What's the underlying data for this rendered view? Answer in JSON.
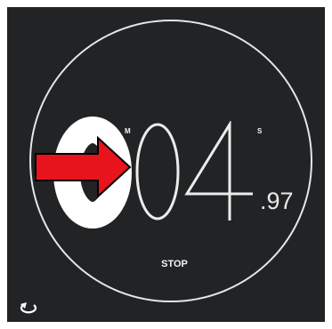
{
  "stopwatch": {
    "minutes": "0",
    "minutes_unit": "M",
    "seconds": "04",
    "seconds_unit": "S",
    "hundredths": ".97"
  },
  "controls": {
    "stop_label": "STOP",
    "reset_icon": "reset-icon"
  },
  "annotation": {
    "arrow_color": "#e8141b",
    "arrow_icon": "right-arrow-icon"
  },
  "colors": {
    "background": "#222325",
    "foreground": "#ffffff"
  }
}
